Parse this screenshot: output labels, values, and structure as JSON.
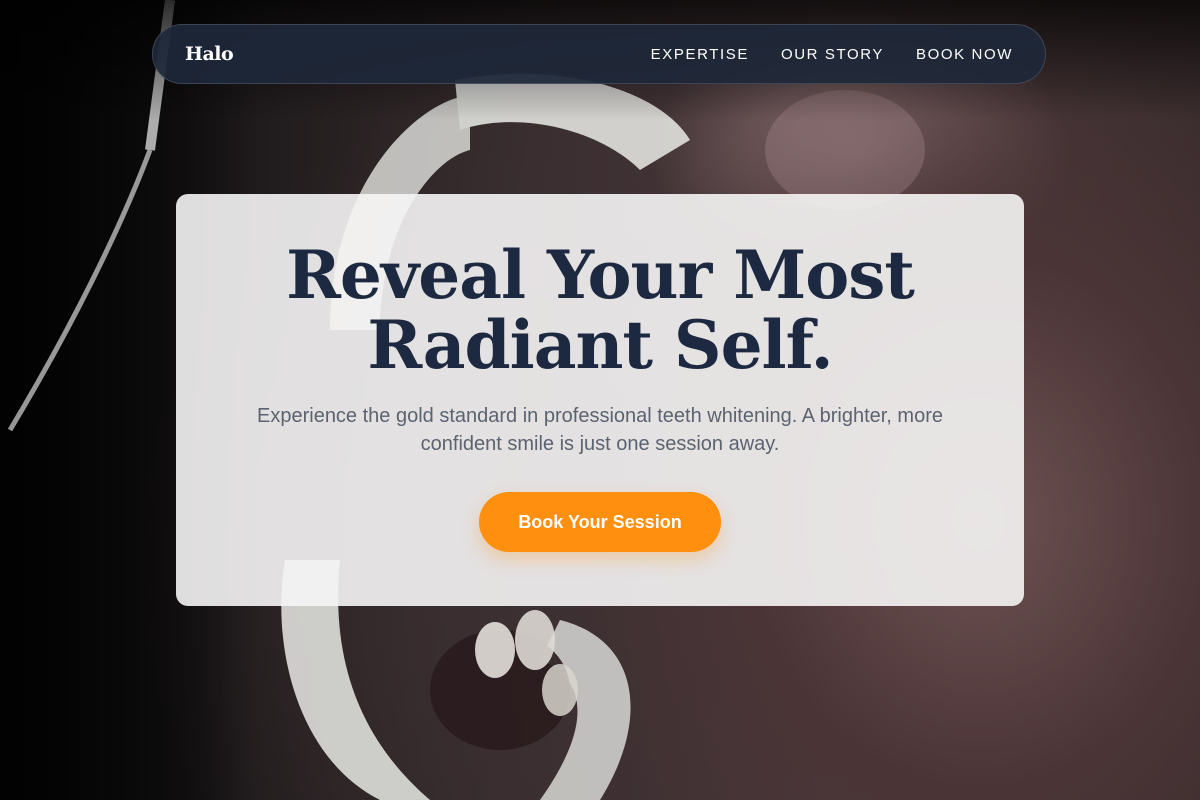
{
  "nav": {
    "brand": "Halo",
    "links": [
      "EXPERTISE",
      "OUR STORY",
      "BOOK NOW"
    ]
  },
  "hero": {
    "title_line1": "Reveal Your Most",
    "title_line2": "Radiant Self.",
    "subtitle": "Experience the gold standard in professional teeth whitening. A brighter, more confident smile is just one session away.",
    "cta_label": "Book Your Session"
  },
  "colors": {
    "nav_background": "#1e283a",
    "title": "#1c2940",
    "accent": "#ff8f0f",
    "subtitle": "#5c6370"
  }
}
